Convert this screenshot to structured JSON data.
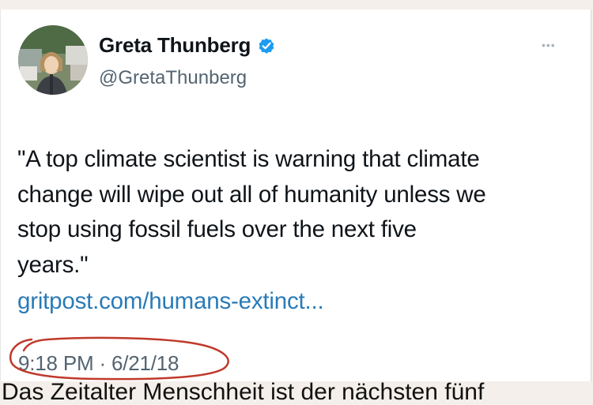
{
  "tweet": {
    "display_name": "Greta Thunberg",
    "handle": "@GretaThunberg",
    "text": "\"A top climate scientist is warning that climate\nchange will wipe out all of humanity unless we\nstop using fossil fuels over the next five\nyears.\"",
    "link": "gritpost.com/humans-extinct...",
    "time": "9:18 PM",
    "separator": "·",
    "date": "6/21/18",
    "more_icon": "more-options-icon",
    "verified_icon": "verified-badge-icon"
  },
  "colors": {
    "link": "#2a7bb7",
    "verified": "#1d9bf0",
    "annotation": "#c0392b"
  },
  "caption": {
    "text": "Das Zeitalter Menschheit ist der nächsten fünf"
  }
}
